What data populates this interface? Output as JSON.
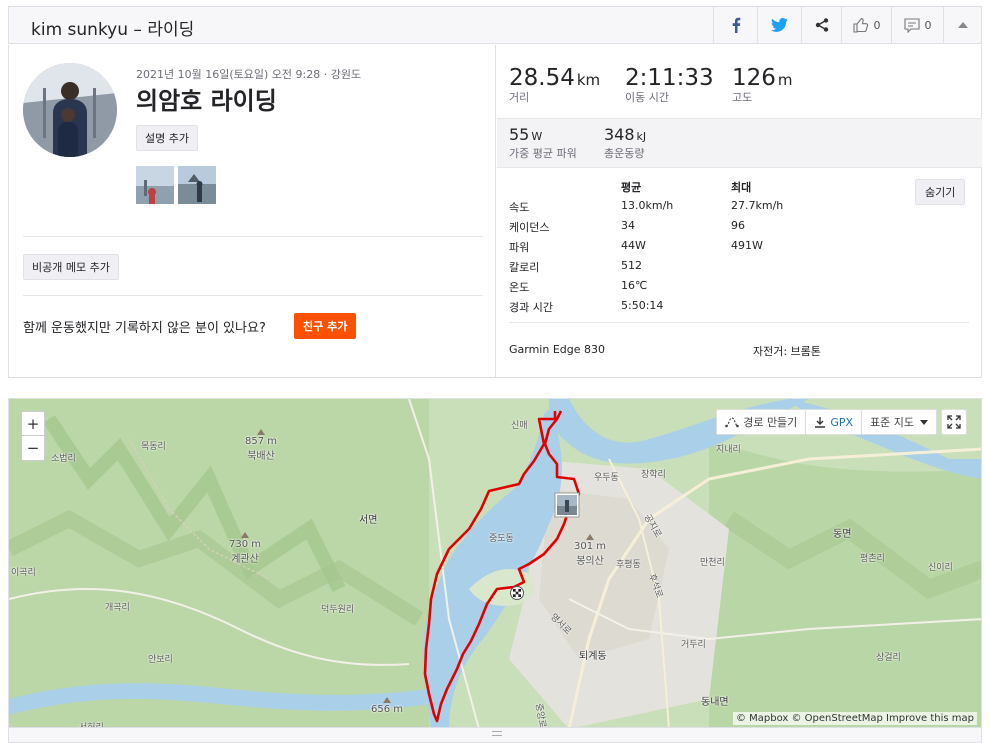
{
  "header": {
    "title": "kim sunkyu – 라이딩",
    "kudos_count": "0",
    "comment_count": "0"
  },
  "activity": {
    "date_location": "2021년 10월 16일(토요일) 오전 9:28 · 강원도",
    "title": "의암호 라이딩",
    "add_description_label": "설명 추가",
    "private_note_label": "비공개 메모 추가",
    "group_prompt": "함께 운동했지만 기록하지 않은 분이 있나요?",
    "add_friend_label": "친구 추가"
  },
  "stats": {
    "distance": {
      "value": "28.54",
      "unit": "km",
      "label": "거리"
    },
    "moving_time": {
      "value": "2:11:33",
      "label": "이동 시간"
    },
    "elevation": {
      "value": "126",
      "unit": "m",
      "label": "고도"
    },
    "power": {
      "value": "55",
      "unit": "W",
      "label": "가중 평균 파워"
    },
    "energy": {
      "value": "348",
      "unit": "kJ",
      "label": "총운동량"
    }
  },
  "details": {
    "col_avg": "평균",
    "col_max": "최대",
    "hide_label": "숨기기",
    "rows": [
      {
        "label": "속도",
        "avg": "13.0km/h",
        "max": "27.7km/h"
      },
      {
        "label": "케이던스",
        "avg": "34",
        "max": "96"
      },
      {
        "label": "파워",
        "avg": "44W",
        "max": "491W"
      },
      {
        "label": "칼로리",
        "avg": "512",
        "max": ""
      },
      {
        "label": "온도",
        "avg": "16℃",
        "max": ""
      },
      {
        "label": "경과 시간",
        "avg": "5:50:14",
        "max": ""
      }
    ],
    "device": "Garmin Edge 830",
    "bike": "자전거: 브롬톤"
  },
  "map": {
    "zoom_in": "+",
    "zoom_out": "−",
    "route_builder_label": "경로 만들기",
    "gpx_label": "GPX",
    "map_type_label": "표준 지도",
    "attribution": "© Mapbox © OpenStreetMap Improve this map",
    "places": {
      "sinmae": "신매",
      "mokdongri": "목동리",
      "sobeopri": "소법리",
      "seomyeon": "서면",
      "ududong": "우두동",
      "janghakri": "장학리",
      "jinaeri": "지내리",
      "jungdodong": "중도동",
      "iksuri": "이곡리",
      "gaegokri": "개곡리",
      "deokduwonri": "덕두원리",
      "anbori": "안보리",
      "seoheori": "서허리",
      "hupyeongdong": "후평동",
      "manchuri": "만천리",
      "dongmyeon": "동면",
      "pyeongchonri": "평촌리",
      "sinyiri": "신이리",
      "yeongseoro": "영서로",
      "toegyedong": "퇴계동",
      "geodusri": "거두리",
      "sanggeolri": "상걸리",
      "dongnaemyeon": "동내면",
      "road1": "공지로",
      "road2": "후석로",
      "road3": "중앙로"
    },
    "peaks": [
      {
        "elev": "857 m",
        "name": "북배산"
      },
      {
        "elev": "730 m",
        "name": "계관산"
      },
      {
        "elev": "301 m",
        "name": "봉의산"
      },
      {
        "elev": "656 m",
        "name": ""
      }
    ]
  },
  "colors": {
    "accent": "#fc5200",
    "route": "#e00000",
    "water": "#a9d0e8",
    "forest": "#b9d6a6"
  }
}
